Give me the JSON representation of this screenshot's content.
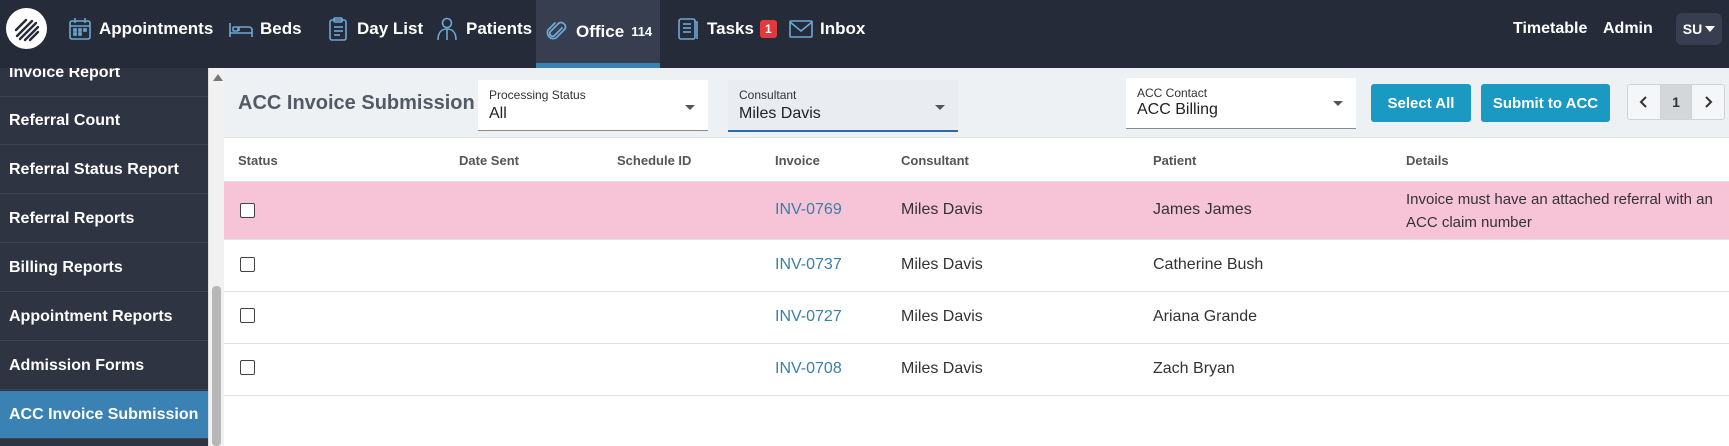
{
  "nav": {
    "items": [
      {
        "label": "Appointments",
        "icon": "calendar-icon"
      },
      {
        "label": "Beds",
        "icon": "bed-icon"
      },
      {
        "label": "Day List",
        "icon": "clipboard-icon"
      },
      {
        "label": "Patients",
        "icon": "person-icon"
      },
      {
        "label": "Office",
        "icon": "paperclip-icon",
        "count": "114"
      },
      {
        "label": "Tasks",
        "icon": "list-icon",
        "count": "1"
      },
      {
        "label": "Inbox",
        "icon": "envelope-icon"
      }
    ],
    "right": {
      "timetable": "Timetable",
      "admin": "Admin",
      "user": "SU"
    },
    "colors": {
      "bar": "#252b38",
      "active": "#3a82b4",
      "alert": "#e23a3a"
    }
  },
  "sidebar": {
    "items": [
      {
        "label": "Invoice Report"
      },
      {
        "label": "Referral Count"
      },
      {
        "label": "Referral Status Report"
      },
      {
        "label": "Referral Reports"
      },
      {
        "label": "Billing Reports"
      },
      {
        "label": "Appointment Reports"
      },
      {
        "label": "Admission Forms"
      },
      {
        "label": "ACC Invoice Submission",
        "active": true
      }
    ]
  },
  "toolbar": {
    "title": "ACC Invoice Submission",
    "processing_status": {
      "label": "Processing Status",
      "value": "All"
    },
    "consultant": {
      "label": "Consultant",
      "value": "Miles Davis"
    },
    "acc_contact": {
      "label": "ACC Contact",
      "value": "ACC Billing"
    },
    "select_all": "Select All",
    "submit": "Submit to ACC",
    "pager": {
      "prev": "‹",
      "page": "1",
      "next": "›"
    }
  },
  "table": {
    "headers": [
      "Status",
      "Date Sent",
      "Schedule ID",
      "Invoice",
      "Consultant",
      "Patient",
      "Details"
    ],
    "rows": [
      {
        "status": "",
        "date_sent": "",
        "schedule_id": "",
        "invoice": "INV-0769",
        "consultant": "Miles Davis",
        "patient": "James James",
        "details": "Invoice must have an attached referral with an ACC claim number",
        "error": true
      },
      {
        "status": "",
        "date_sent": "",
        "schedule_id": "",
        "invoice": "INV-0737",
        "consultant": "Miles Davis",
        "patient": "Catherine Bush",
        "details": ""
      },
      {
        "status": "",
        "date_sent": "",
        "schedule_id": "",
        "invoice": "INV-0727",
        "consultant": "Miles Davis",
        "patient": "Ariana Grande",
        "details": ""
      },
      {
        "status": "",
        "date_sent": "",
        "schedule_id": "",
        "invoice": "INV-0708",
        "consultant": "Miles Davis",
        "patient": "Zach Bryan",
        "details": ""
      }
    ]
  }
}
